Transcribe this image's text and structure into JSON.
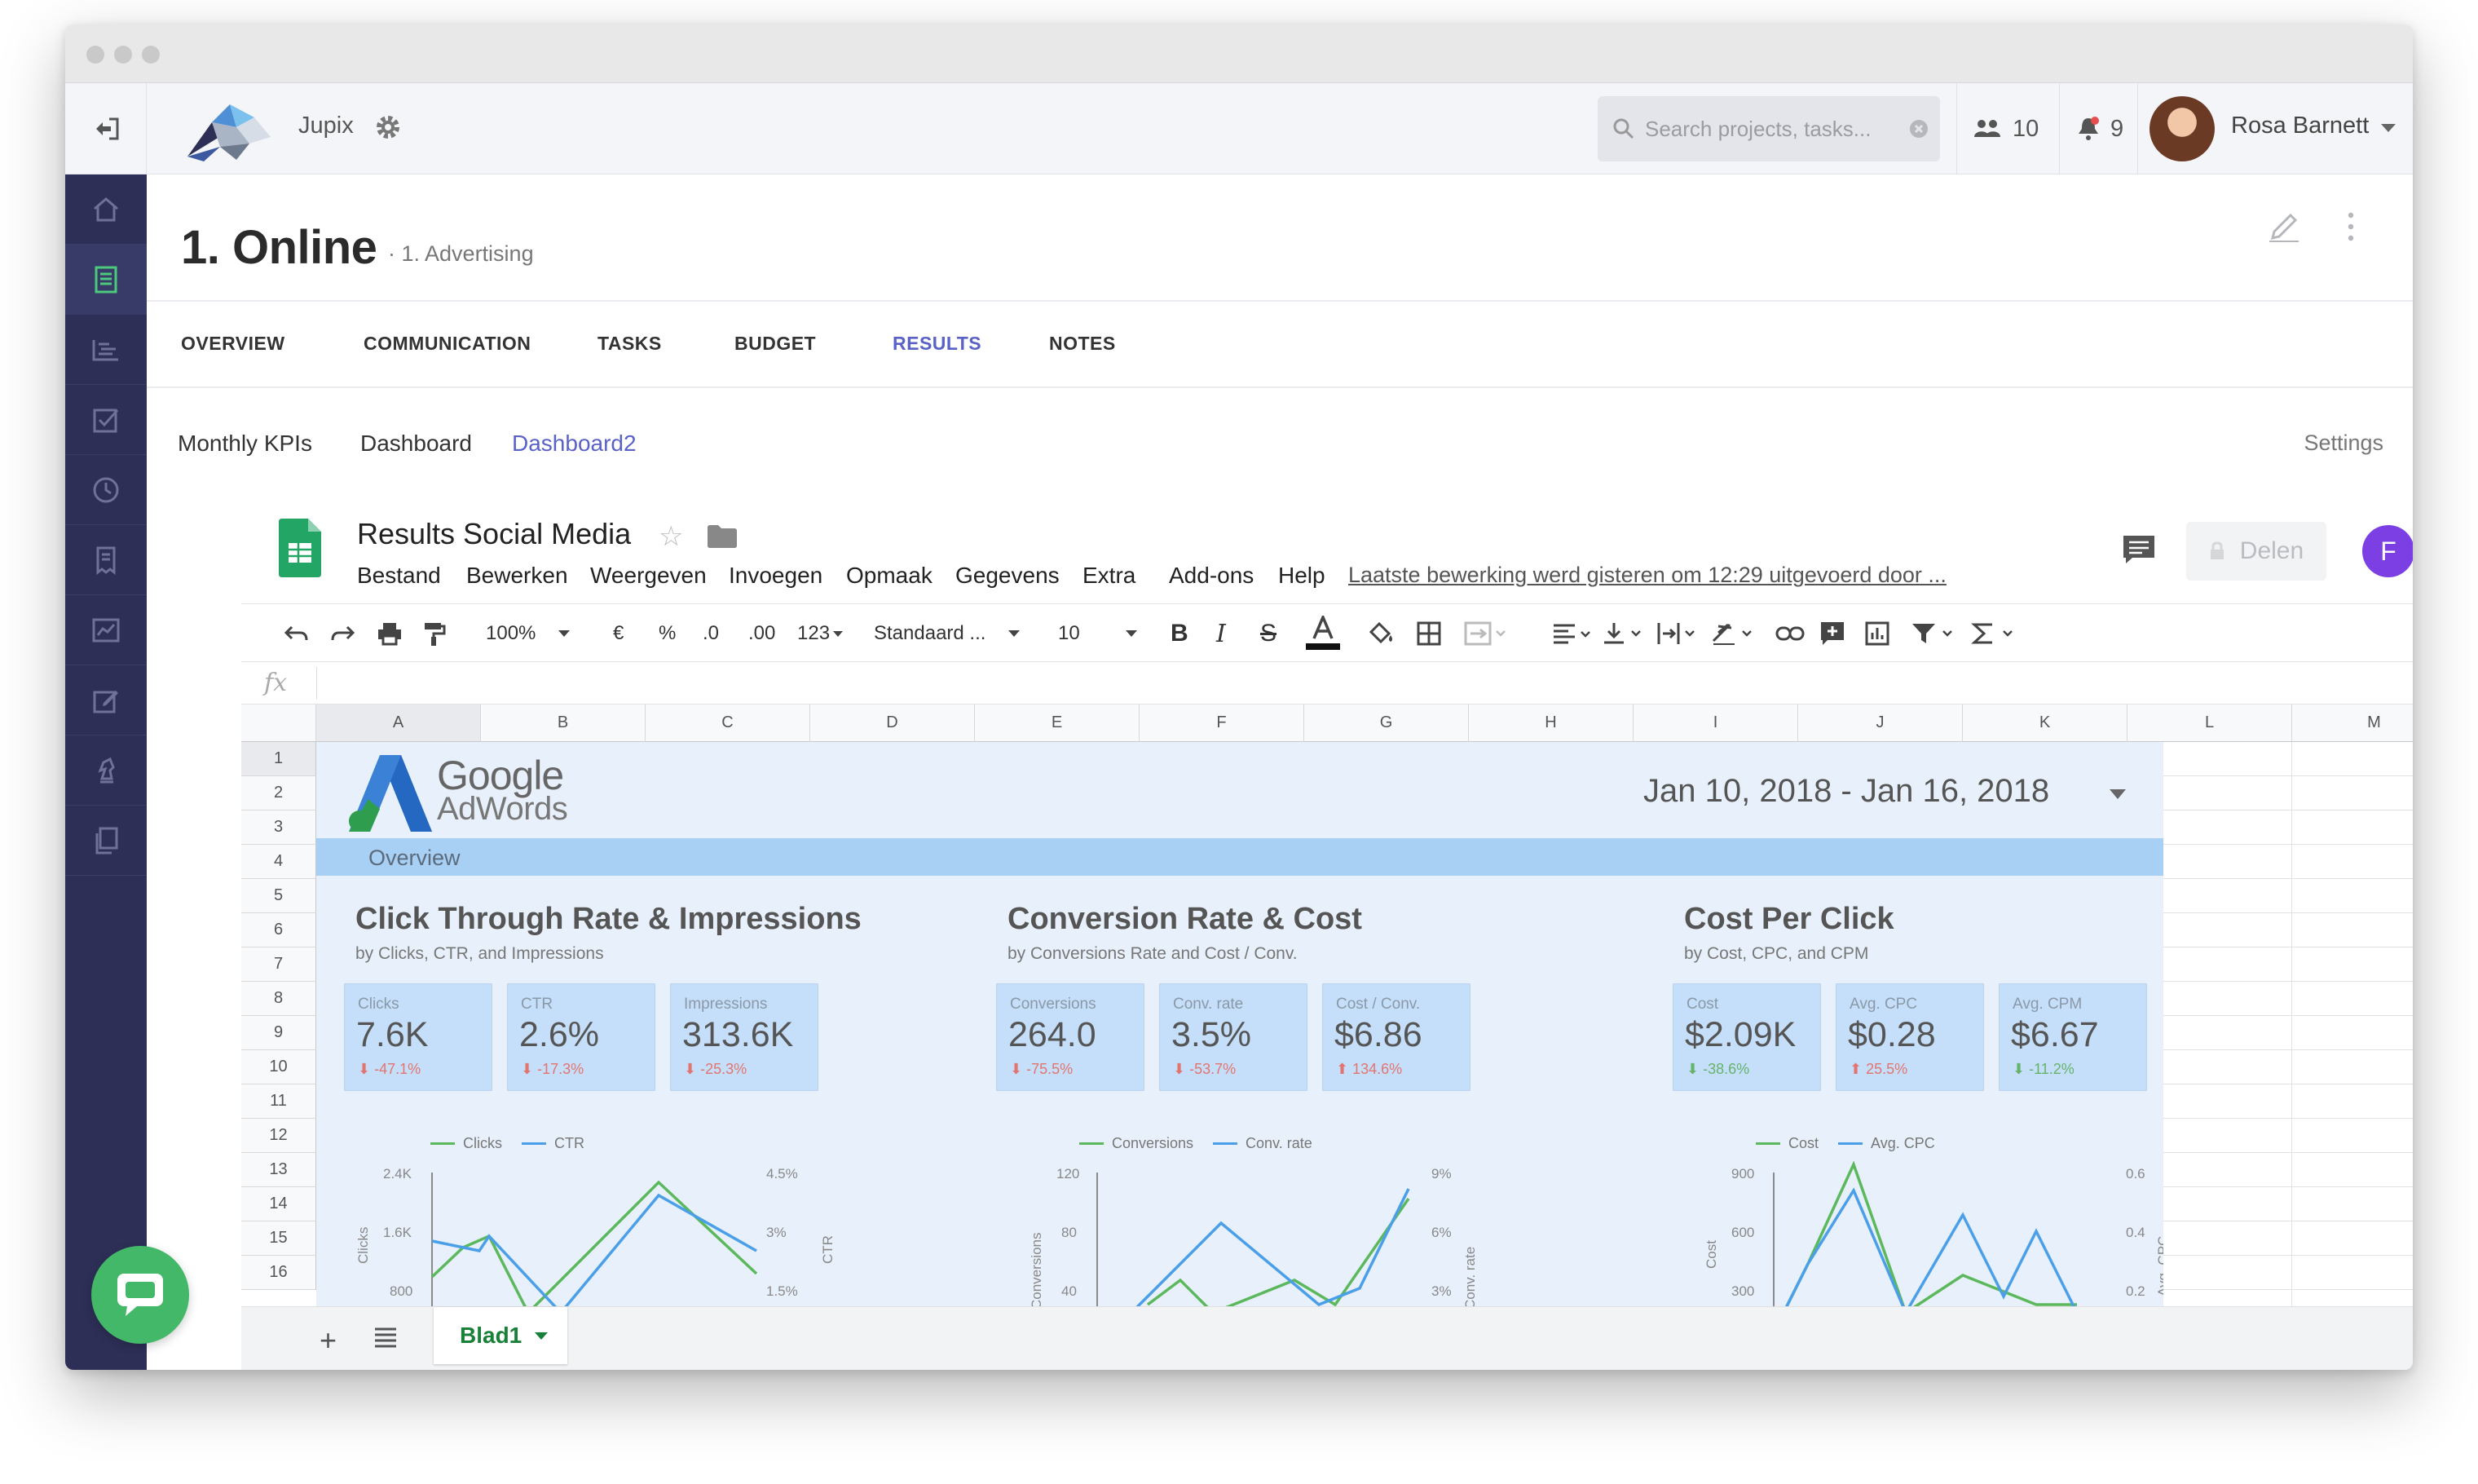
{
  "brand": {
    "name": "Jupix"
  },
  "search": {
    "placeholder": "Search projects, tasks..."
  },
  "header": {
    "team_count": "10",
    "notification_count": "9",
    "user_name": "Rosa Barnett"
  },
  "page": {
    "title": "1. Online",
    "subtitle": "· 1. Advertising"
  },
  "tabs": [
    {
      "label": "OVERVIEW"
    },
    {
      "label": "COMMUNICATION"
    },
    {
      "label": "TASKS"
    },
    {
      "label": "BUDGET"
    },
    {
      "label": "RESULTS",
      "active": true
    },
    {
      "label": "NOTES"
    }
  ],
  "subtabs": [
    {
      "label": "Monthly KPIs"
    },
    {
      "label": "Dashboard"
    },
    {
      "label": "Dashboard2",
      "active": true
    }
  ],
  "settings_label": "Settings",
  "sheet": {
    "title": "Results Social Media",
    "menu": [
      "Bestand",
      "Bewerken",
      "Weergeven",
      "Invoegen",
      "Opmaak",
      "Gegevens",
      "Extra",
      "Add-ons",
      "Help"
    ],
    "last_edit": "Laatste bewerking werd gisteren om 12:29 uitgevoerd door ...",
    "share_label": "Delen",
    "user_initial": "F",
    "toolbar": {
      "zoom": "100%",
      "currency": "€",
      "percent": "%",
      "dec_decrease": ".0",
      "dec_increase": ".00",
      "more_formats": "123",
      "font": "Standaard ...",
      "font_size": "10"
    },
    "fx_label": "fx",
    "columns": [
      "A",
      "B",
      "C",
      "D",
      "E",
      "F",
      "G",
      "H",
      "I",
      "J",
      "K",
      "L",
      "M"
    ],
    "rows": [
      "1",
      "2",
      "3",
      "4",
      "5",
      "6",
      "7",
      "8",
      "9",
      "10",
      "11",
      "12",
      "13",
      "14",
      "15",
      "16"
    ],
    "tab_name": "Blad1"
  },
  "report": {
    "logo_line1": "Google",
    "logo_line2": "AdWords",
    "date_range": "Jan 10, 2018 - Jan 16, 2018",
    "overview_label": "Overview",
    "sections": [
      {
        "title": "Click Through Rate & Impressions",
        "subtitle": "by Clicks, CTR, and Impressions",
        "kpis": [
          {
            "label": "Clicks",
            "value": "7.6K",
            "delta": "⬇ -47.1%"
          },
          {
            "label": "CTR",
            "value": "2.6%",
            "delta": "⬇ -17.3%"
          },
          {
            "label": "Impressions",
            "value": "313.6K",
            "delta": "⬇ -25.3%"
          }
        ],
        "legend": [
          "Clicks",
          "CTR"
        ],
        "left_axis": [
          "2.4K",
          "1.6K",
          "800"
        ],
        "right_axis": [
          "4.5%",
          "3%",
          "1.5%"
        ],
        "left_title": "Clicks",
        "right_title": "CTR"
      },
      {
        "title": "Conversion Rate & Cost",
        "subtitle": "by Conversions Rate and Cost / Conv.",
        "kpis": [
          {
            "label": "Conversions",
            "value": "264.0",
            "delta": "⬇ -75.5%"
          },
          {
            "label": "Conv. rate",
            "value": "3.5%",
            "delta": "⬇ -53.7%"
          },
          {
            "label": "Cost / Conv.",
            "value": "$6.86",
            "delta": "⬆ 134.6%"
          }
        ],
        "legend": [
          "Conversions",
          "Conv. rate"
        ],
        "left_axis": [
          "120",
          "80",
          "40"
        ],
        "right_axis": [
          "9%",
          "6%",
          "3%"
        ],
        "left_title": "Conversions",
        "right_title": "Conv. rate"
      },
      {
        "title": "Cost Per Click",
        "subtitle": "by Cost, CPC, and CPM",
        "kpis": [
          {
            "label": "Cost",
            "value": "$2.09K",
            "delta": "⬇ -38.6%"
          },
          {
            "label": "Avg. CPC",
            "value": "$0.28",
            "delta": "⬆ 25.5%"
          },
          {
            "label": "Avg. CPM",
            "value": "$6.67",
            "delta": "⬇ -11.2%"
          }
        ],
        "legend": [
          "Cost",
          "Avg. CPC"
        ],
        "left_axis": [
          "900",
          "600",
          "300"
        ],
        "right_axis": [
          "0.6",
          "0.4",
          "0.2"
        ],
        "left_title": "Cost",
        "right_title": "Avg. CPC"
      }
    ]
  },
  "colors": {
    "accent": "#5a62c8",
    "sidebar": "#2e2f57",
    "sheets_green": "#188038",
    "chat_green": "#43b868",
    "series_green": "#5cb85c",
    "series_blue": "#4a9fe8"
  }
}
